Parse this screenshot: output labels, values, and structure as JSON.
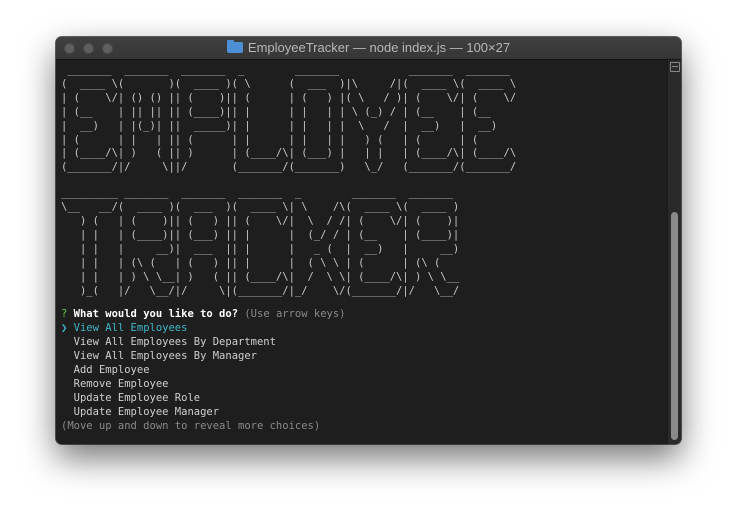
{
  "window": {
    "title": "EmployeeTracker — node index.js — 100×27",
    "folder_icon": "folder-icon"
  },
  "terminal": {
    "banner_employee": [
      " _______  _______  _______  _        _______           _______  _______ ",
      "(  ____ \\(       )(  ____ )( \\      (  ___  )|\\     /|(  ____ \\(  ____ \\",
      "| (    \\/| () () || (    )|| (      | (   ) |( \\   / )| (    \\/| (    \\/",
      "| (__    | || || || (____)|| |      | |   | | \\ (_) / | (__    | (__    ",
      "|  __)   | |(_)| ||  _____)| |      | |   | |  \\   /  |  __)   |  __)   ",
      "| (      | |   | || (      | |      | |   | |   ) (   | (      | (      ",
      "| (____/\\| )   ( || )      | (____/\\| (___) |   | |   | (____/\\| (____/\\",
      "(_______/|/     \\||/       (_______/(_______)   \\_/   (_______/(_______/"
    ],
    "banner_tracker": [
      "_________ _______  _______  _______  _        _______  _______ ",
      "\\__   __/(  ____ )(  ___  )(  ____ \\| \\    /\\(  ____ \\(  ____ )",
      "   ) (   | (    )|| (   ) || (    \\/|  \\  / /| (    \\/| (    )|",
      "   | |   | (____)|| (___) || |      |  (_/ / | (__    | (____)|",
      "   | |   |     __)|  ___  || |      |   _ (  |  __)   |     __)",
      "   | |   | (\\ (   | (   ) || |      |  ( \\ \\ | (      | (\\ (   ",
      "   | |   | ) \\ \\__| )   ( || (____/\\|  /  \\ \\| (____/\\| ) \\ \\__",
      "   )_(   |/   \\__/|/     \\|(_______/|_/    \\/(_______/|/   \\__/"
    ],
    "prompt": {
      "marker": "?",
      "question": "What would you like to do?",
      "hint": "(Use arrow keys)"
    },
    "pointer": "❯",
    "choices": [
      "View All Employees",
      "View All Employees By Department",
      "View All Employees By Manager",
      "Add Employee",
      "Remove Employee",
      "Update Employee Role",
      "Update Employee Manager"
    ],
    "footer_hint": "(Move up and down to reveal more choices)"
  }
}
